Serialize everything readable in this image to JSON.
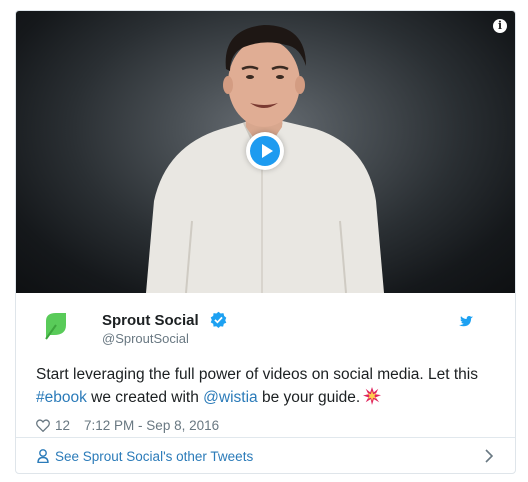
{
  "video": {
    "info_glyph": "i"
  },
  "tweet": {
    "author_name": "Sprout Social",
    "author_handle": "@SproutSocial",
    "text_part1": "Start leveraging the full power of videos on social media. Let this ",
    "hashtag": "#ebook",
    "text_part2": " we created with ",
    "mention": "@wistia",
    "text_part3": " be your guide.",
    "like_count": "12",
    "timestamp": "7:12 PM - Sep 8, 2016"
  },
  "footer": {
    "cta": "See Sprout Social's other Tweets"
  },
  "colors": {
    "link": "#2b7bb9",
    "play_button": "#1d9bf0",
    "logo_green": "#59cb59",
    "verified": "#1da1f2",
    "burst": "#e0245e"
  },
  "icons": [
    "info-icon",
    "play-icon",
    "sprout-logo-icon",
    "verified-badge-icon",
    "twitter-bird-icon",
    "collision-emoji-icon",
    "heart-icon",
    "person-icon",
    "chevron-right-icon"
  ]
}
